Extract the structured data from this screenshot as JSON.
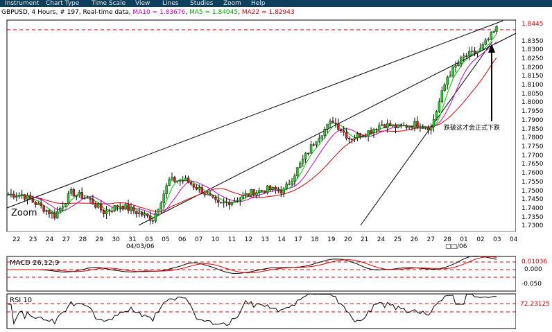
{
  "menu": [
    "Instrument",
    "Chart Type",
    "Time Scale",
    "View",
    "Lines",
    "Studies",
    "Zoom",
    "Help"
  ],
  "header": {
    "symbol": "GBPUSD",
    "interval": ", 4 Hours",
    "bars": ", # 197, Real-time data",
    "ma10": "MA10 = 1.83676",
    "ma5": "MA5 = 1.84045",
    "ma22": "MA22 = 1.82943",
    "ma10_color": "#cc00cc",
    "ma5_color": "#00cc00",
    "ma22_color": "#dd0000"
  },
  "price_axis": [
    "1.8445",
    "1.8350",
    "1.8300",
    "1.8250",
    "1.8200",
    "1.8150",
    "1.8100",
    "1.8050",
    "1.8000",
    "1.7950",
    "1.7900",
    "1.7850",
    "1.7800",
    "1.7750",
    "1.7700",
    "1.7650",
    "1.7600",
    "1.7550",
    "1.7500",
    "1.7450",
    "1.7400",
    "1.7350",
    "1.7300"
  ],
  "date_axis": [
    "22",
    "23",
    "24",
    "27",
    "28",
    "29",
    "30",
    "31",
    "03",
    "05",
    "06",
    "07",
    "10",
    "11",
    "12",
    "13",
    "14",
    "17",
    "18",
    "19",
    "20",
    "21",
    "24",
    "25",
    "26",
    "27",
    "28",
    "01",
    "02",
    "03",
    "04"
  ],
  "month_labels": [
    "04/03/06",
    "□□/06"
  ],
  "zoom_label": "Zoom",
  "annotation": "跌破这才会正式下跌",
  "macd": {
    "title": "MACD 26,12,9",
    "labels": [
      "0.01036",
      "0.000",
      "-0.050"
    ]
  },
  "rsi": {
    "title": "RSI 10",
    "labels": [
      "72.23125"
    ]
  },
  "chart_data": {
    "type": "candlestick",
    "instrument": "GBPUSD",
    "interval": "4 Hours",
    "x": [
      "22",
      "23",
      "24",
      "27",
      "28",
      "29",
      "30",
      "31",
      "03",
      "05",
      "06",
      "07",
      "10",
      "11",
      "12",
      "13",
      "14",
      "17",
      "18",
      "19",
      "20",
      "21",
      "24",
      "25",
      "26",
      "27",
      "28",
      "01",
      "02",
      "03"
    ],
    "close": [
      1.748,
      1.742,
      1.736,
      1.749,
      1.746,
      1.738,
      1.742,
      1.738,
      1.734,
      1.756,
      1.756,
      1.75,
      1.742,
      1.745,
      1.749,
      1.751,
      1.75,
      1.765,
      1.78,
      1.79,
      1.78,
      1.783,
      1.788,
      1.786,
      1.788,
      1.786,
      1.815,
      1.826,
      1.83,
      1.842
    ],
    "ma10_last": 1.83676,
    "ma5_last": 1.84045,
    "ma22_last": 1.82943,
    "current_price": 1.8445,
    "ylim": [
      1.727,
      1.847
    ],
    "macd": {
      "last": 0.01036,
      "levels": [
        0.0,
        -0.05
      ]
    },
    "rsi": {
      "last": 72.23125
    }
  }
}
